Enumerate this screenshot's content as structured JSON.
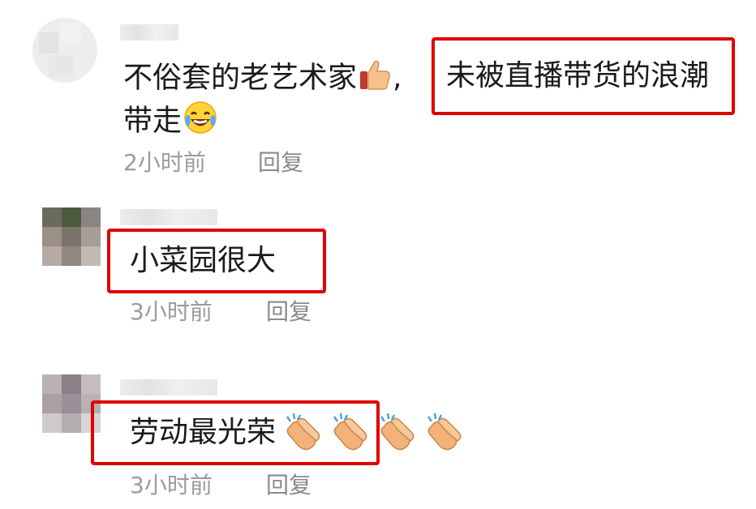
{
  "comments": [
    {
      "text_line1": "不俗套的老艺术家",
      "comma": ",",
      "highlight": "未被直播带货的浪潮",
      "text_line2": "带走",
      "time": "2小时前",
      "reply": "回复",
      "emojis": [
        "thumbs-up-icon",
        "laughing-crying-face-icon"
      ]
    },
    {
      "highlight": "小菜园很大",
      "time": "3小时前",
      "reply": "回复"
    },
    {
      "highlight": "劳动最光荣",
      "time": "3小时前",
      "reply": "回复",
      "emojis": [
        "clapping-hands-icon",
        "clapping-hands-icon",
        "clapping-hands-icon",
        "clapping-hands-icon"
      ]
    }
  ],
  "colors": {
    "highlight_border": "#e00000",
    "text": "#1a1a1a",
    "meta": "#9b9b9b"
  }
}
